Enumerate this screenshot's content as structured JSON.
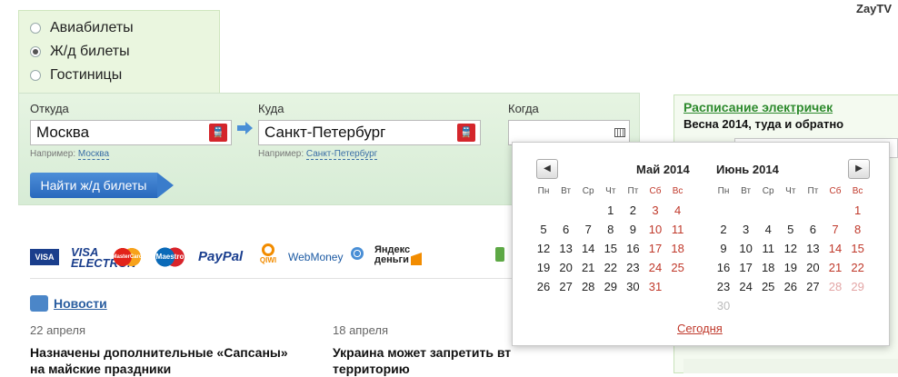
{
  "brand": "ZayTV",
  "ticket_types": [
    {
      "label": "Авиабилеты",
      "checked": false
    },
    {
      "label": "Ж/д билеты",
      "checked": true
    },
    {
      "label": "Гостиницы",
      "checked": false
    }
  ],
  "search": {
    "from_label": "Откуда",
    "from_value": "Москва",
    "from_hint_prefix": "Например:",
    "from_hint_example": "Москва",
    "to_label": "Куда",
    "to_value": "Санкт-Петербург",
    "to_hint_prefix": "Например:",
    "to_hint_example": "Санкт-Петербург",
    "when_label": "Когда",
    "find_button": "Найти ж/д билеты"
  },
  "payments": [
    "VISA",
    "VISA ELECTRON",
    "MasterCard",
    "Maestro",
    "PayPal",
    "QIWI",
    "WebMoney",
    "Яндекс деньги"
  ],
  "news": {
    "link": "Новости",
    "items": [
      {
        "date": "22 апреля",
        "title_line1": "Назначены дополнительные «Сапсаны»",
        "title_line2": "на майские праздники"
      },
      {
        "date": "18 апреля",
        "title_line1": "Украина может запретить вт",
        "title_line2": "территорию"
      }
    ]
  },
  "schedule": {
    "title": "Расписание электричек",
    "subtitle": "Весна 2014, туда и обратно"
  },
  "calendar": {
    "today_link": "Сегодня",
    "weekdays": [
      "Пн",
      "Вт",
      "Ср",
      "Чт",
      "Пт",
      "Сб",
      "Вс"
    ],
    "months": [
      {
        "title": "Май 2014",
        "rows": [
          [
            "",
            "",
            "",
            "1",
            "2",
            "3",
            "4"
          ],
          [
            "5",
            "6",
            "7",
            "8",
            "9",
            "10",
            "11"
          ],
          [
            "12",
            "13",
            "14",
            "15",
            "16",
            "17",
            "18"
          ],
          [
            "19",
            "20",
            "21",
            "22",
            "23",
            "24",
            "25"
          ],
          [
            "26",
            "27",
            "28",
            "29",
            "30",
            "31",
            ""
          ]
        ]
      },
      {
        "title": "Июнь 2014",
        "rows": [
          [
            "",
            "",
            "",
            "",
            "",
            "",
            "1"
          ],
          [
            "2",
            "3",
            "4",
            "5",
            "6",
            "7",
            "8"
          ],
          [
            "9",
            "10",
            "11",
            "12",
            "13",
            "14",
            "15"
          ],
          [
            "16",
            "17",
            "18",
            "19",
            "20",
            "21",
            "22"
          ],
          [
            "23",
            "24",
            "25",
            "26",
            "27",
            "28",
            "29"
          ],
          [
            "30",
            "",
            "",
            "",
            "",
            "",
            ""
          ]
        ],
        "dim_from_row": 4,
        "dim_from_col": 5
      }
    ],
    "accent_color": "#c0392b"
  }
}
